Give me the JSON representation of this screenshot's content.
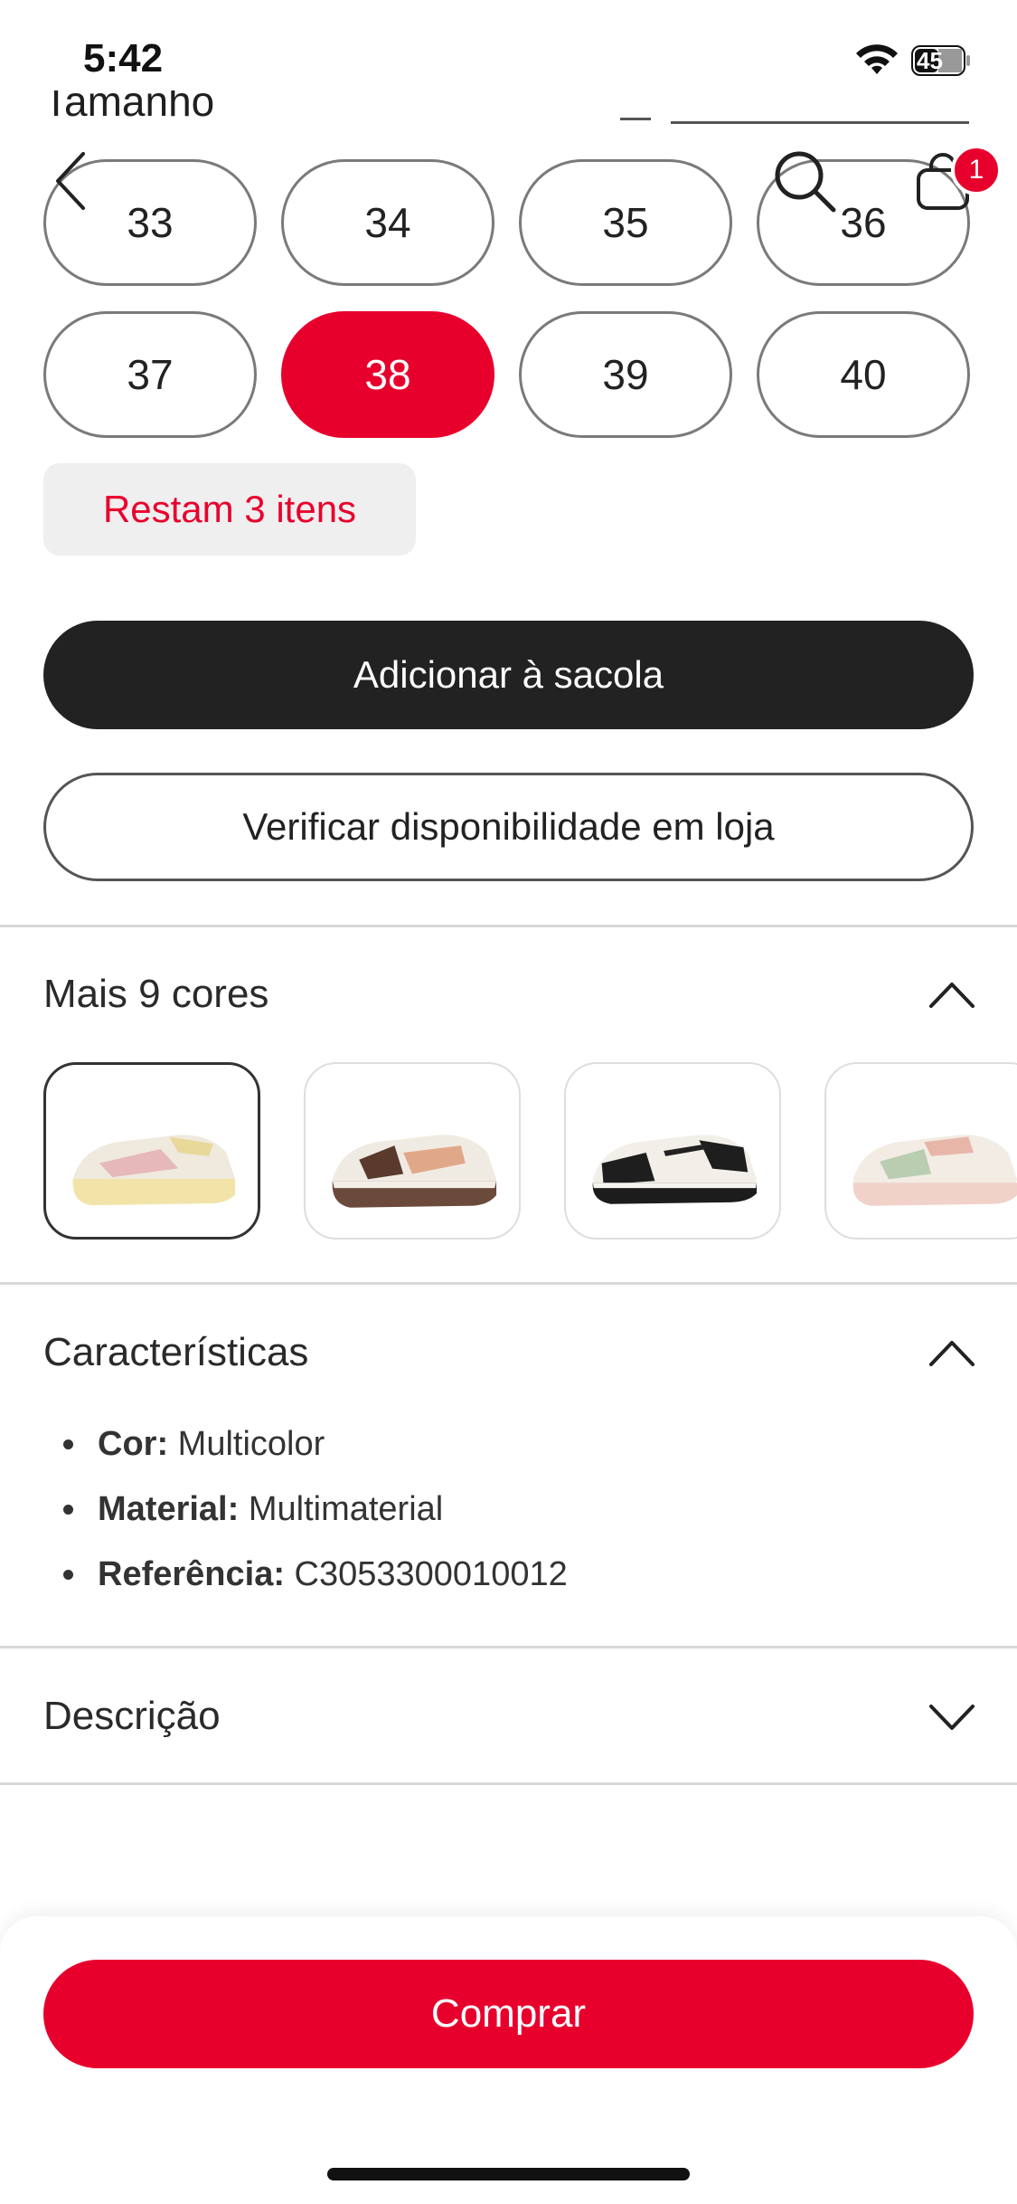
{
  "status_bar": {
    "time": "5:42",
    "battery": "45"
  },
  "size_section": {
    "clipped_heading": "Tamanho",
    "sizes": [
      {
        "label": "33",
        "selected": false
      },
      {
        "label": "34",
        "selected": false
      },
      {
        "label": "35",
        "selected": false
      },
      {
        "label": "36",
        "selected": false
      },
      {
        "label": "37",
        "selected": false
      },
      {
        "label": "38",
        "selected": true
      },
      {
        "label": "39",
        "selected": false
      },
      {
        "label": "40",
        "selected": false
      }
    ],
    "stock_notice": "Restam 3 itens"
  },
  "nav": {
    "back_icon": "chevron-left-icon",
    "search_icon": "search-icon",
    "bag_icon": "shopping-bag-icon",
    "bag_count": "1"
  },
  "actions": {
    "add_to_bag": "Adicionar à sacola",
    "check_store": "Verificar disponibilidade em loja",
    "buy": "Comprar"
  },
  "colors_section": {
    "title": "Mais 9 cores",
    "expanded": true,
    "selected_index": 0
  },
  "characteristics": {
    "title": "Características",
    "expanded": true,
    "items": [
      {
        "key": "Cor:",
        "value": "Multicolor"
      },
      {
        "key": "Material:",
        "value": "Multimaterial"
      },
      {
        "key": "Referência:",
        "value": "C3053300010012"
      }
    ]
  },
  "description": {
    "title": "Descrição",
    "expanded": false
  },
  "theme": {
    "accent": "#e8002d",
    "dark_button": "#222222"
  }
}
